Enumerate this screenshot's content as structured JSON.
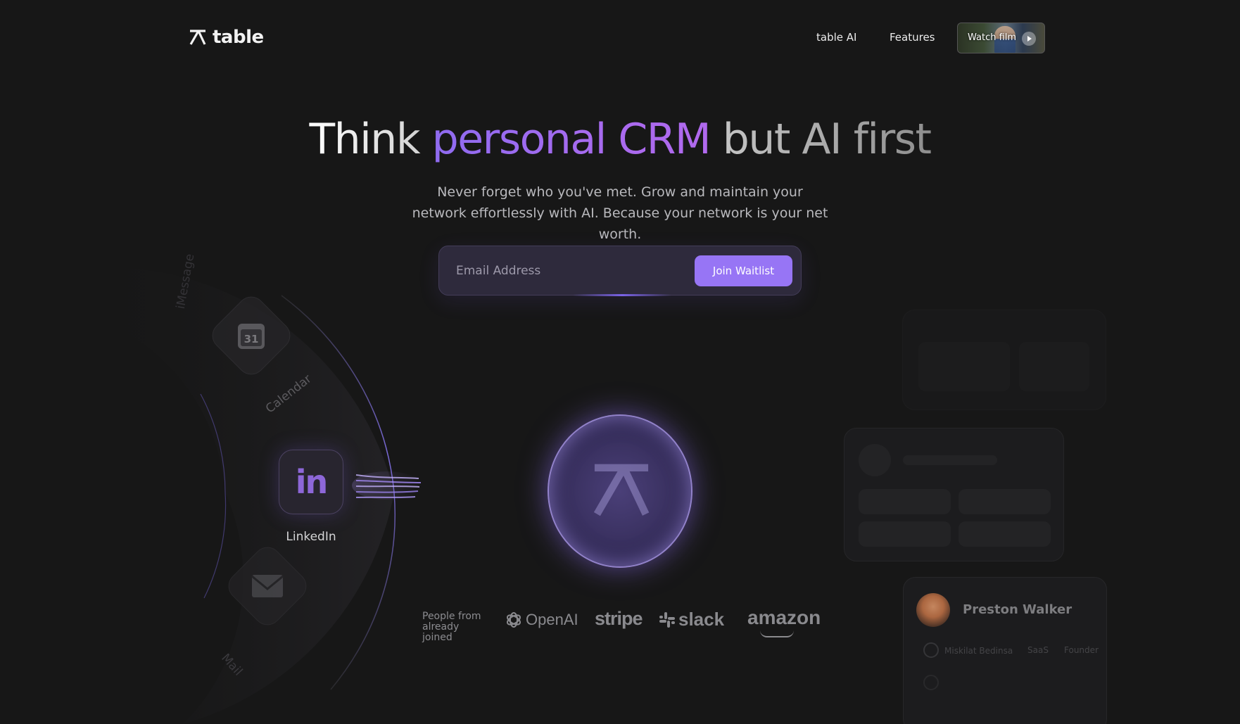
{
  "nav": {
    "logo_text": "table",
    "links": [
      "table AI",
      "Features"
    ],
    "watch_label": "Watch film"
  },
  "hero": {
    "title_part1": "Think ",
    "title_highlight": "personal CRM",
    "title_part2": " but AI first",
    "subtitle": "Never forget who you've met. Grow and maintain your network effortlessly with AI. Because your network is your net worth."
  },
  "signup": {
    "email_placeholder": "Email Address",
    "button_label": "Join Waitlist"
  },
  "integrations": {
    "calendar_label": "Calendar",
    "calendar_day": "31",
    "imessage_label": "iMessage",
    "linkedin_glyph": "in",
    "linkedin_label": "LinkedIn",
    "mail_label": "Mail"
  },
  "brands": {
    "lead": "People from already joined",
    "items": [
      "OpenAI",
      "stripe",
      "slack",
      "amazon"
    ]
  },
  "contact_card": {
    "name": "Preston Walker",
    "row1_company": "Miskilat Bedinsa",
    "row1_tag1": "SaaS",
    "row1_tag2": "Founder"
  },
  "colors": {
    "background": "#171717",
    "accent": "#9775f5",
    "highlight": "#a86bef"
  }
}
